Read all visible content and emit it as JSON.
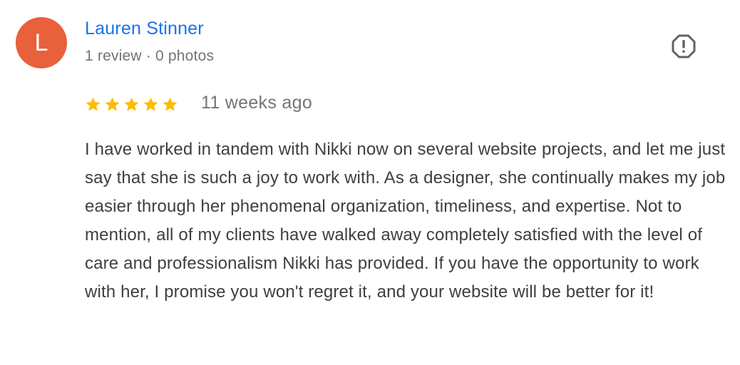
{
  "review": {
    "author": {
      "initial": "L",
      "name": "Lauren Stinner",
      "review_count": "1 review",
      "separator": "·",
      "photo_count": "0 photos"
    },
    "rating": 5,
    "rating_max": 5,
    "date": "11 weeks ago",
    "text": "I have worked in tandem with Nikki now on several website projects, and let me just say that she is such a joy to work with. As a designer, she continually makes my job easier through her phenomenal organization, timeliness, and expertise. Not to mention, all of my clients have walked away completely satisfied with the level of care and professionalism Nikki has provided. If you have the opportunity to work with her, I promise you won't regret it, and your website will be better for it!"
  },
  "icons": {
    "flag": "report-flag-icon",
    "star": "star-icon"
  },
  "colors": {
    "avatar_bg": "#e8603c",
    "name": "#1a73e8",
    "star": "#fbbc04",
    "meta": "#70757a",
    "body": "#3c4043"
  }
}
